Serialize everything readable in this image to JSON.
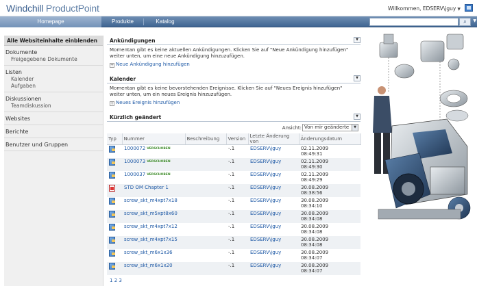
{
  "header": {
    "logo_main": "Windchill",
    "logo_product": "ProductPoint",
    "welcome": "Willkommen, EDSERV\\jguy"
  },
  "nav": {
    "tabs": [
      "Homepage",
      "Produkte",
      "Katalog"
    ],
    "search_value": ""
  },
  "sidebar": {
    "header": "Alle Websiteinhalte einblenden",
    "groups": [
      {
        "label": "Dokumente",
        "children": [
          "Freigegebene Dokumente"
        ]
      },
      {
        "label": "Listen",
        "children": [
          "Kalender",
          "Aufgaben"
        ]
      },
      {
        "label": "Diskussionen",
        "children": [
          "Teamdiskussion"
        ]
      },
      {
        "label": "Websites",
        "children": []
      },
      {
        "label": "Berichte",
        "children": []
      },
      {
        "label": "Benutzer und Gruppen",
        "children": []
      }
    ]
  },
  "announcements": {
    "title": "Ankündigungen",
    "text": "Momentan gibt es keine aktuellen Ankündigungen. Klicken Sie auf \"Neue Ankündigung hinzufügen\" weiter unten, um eine neue Ankündigung hinzuzufügen.",
    "add_link": "Neue Ankündigung hinzufügen"
  },
  "calendar": {
    "title": "Kalender",
    "text": "Momentan gibt es keine bevorstehenden Ereignisse. Klicken Sie auf \"Neues Ereignis hinzufügen\" weiter unten, um ein neues Ereignis hinzuzufügen.",
    "add_link": "Neues Ereignis hinzufügen"
  },
  "recent": {
    "title": "Kürzlich geändert",
    "view_label": "Ansicht:",
    "view_value": "Von mir geänderte",
    "columns": [
      "Typ",
      "Nummer",
      "Beschreibung",
      "Version",
      "Letzte Änderung von",
      "Änderungsdatum"
    ],
    "rows": [
      {
        "type": "doc",
        "number": "1000072",
        "badge": "VERSCHOBEN",
        "description": "",
        "version": "-.1",
        "modified_by": "EDSERV\\jguy",
        "date": "02.11.2009",
        "time": "08:49:31"
      },
      {
        "type": "doc",
        "number": "1000073",
        "badge": "VERSCHOBEN",
        "description": "",
        "version": "-.1",
        "modified_by": "EDSERV\\jguy",
        "date": "02.11.2009",
        "time": "08:49:30"
      },
      {
        "type": "doc",
        "number": "1000037",
        "badge": "VERSCHOBEN",
        "description": "",
        "version": "-.1",
        "modified_by": "EDSERV\\jguy",
        "date": "02.11.2009",
        "time": "08:49:29"
      },
      {
        "type": "pdf",
        "number": "STD OM Chapter 1",
        "badge": "",
        "description": "",
        "version": "-.1",
        "modified_by": "EDSERV\\jguy",
        "date": "30.08.2009",
        "time": "08:38:56"
      },
      {
        "type": "doc",
        "number": "screw_skt_m4xpt7x18",
        "badge": "",
        "description": "",
        "version": "-.1",
        "modified_by": "EDSERV\\jguy",
        "date": "30.08.2009",
        "time": "08:34:10"
      },
      {
        "type": "doc",
        "number": "screw_skt_m5xpt8x60",
        "badge": "",
        "description": "",
        "version": "-.1",
        "modified_by": "EDSERV\\jguy",
        "date": "30.08.2009",
        "time": "08:34:08"
      },
      {
        "type": "doc",
        "number": "screw_skt_m4xpt7x12",
        "badge": "",
        "description": "",
        "version": "-.1",
        "modified_by": "EDSERV\\jguy",
        "date": "30.08.2009",
        "time": "08:34:08"
      },
      {
        "type": "doc",
        "number": "screw_skt_m4xpt7x15",
        "badge": "",
        "description": "",
        "version": "-.1",
        "modified_by": "EDSERV\\jguy",
        "date": "30.08.2009",
        "time": "08:34:08"
      },
      {
        "type": "doc",
        "number": "screw_skt_m6x1x36",
        "badge": "",
        "description": "",
        "version": "-.1",
        "modified_by": "EDSERV\\jguy",
        "date": "30.08.2009",
        "time": "08:34:07"
      },
      {
        "type": "doc",
        "number": "screw_skt_m6x1x20",
        "badge": "",
        "description": "",
        "version": "-.1",
        "modified_by": "EDSERV\\jguy",
        "date": "30.08.2009",
        "time": "08:34:07"
      }
    ],
    "pages": [
      "1",
      "2",
      "3"
    ]
  },
  "colors": {
    "nav_dark": "#3f6592",
    "link": "#1f5aa6",
    "badge": "#3e8c2a"
  }
}
